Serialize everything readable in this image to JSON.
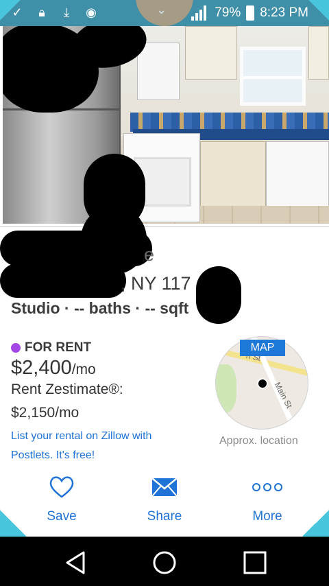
{
  "status_bar": {
    "battery": "79%",
    "time": "8:23 PM",
    "notification_icons": [
      "check-icon",
      "lock-icon",
      "download-icon",
      "messenger-icon"
    ]
  },
  "listing": {
    "address_prefix": "e",
    "address_partial": ", NY 117",
    "facts": "Studio · -- baths · -- sqft",
    "status": "FOR RENT",
    "status_color": "#a547e6",
    "price": "$2,400",
    "price_period": "/mo",
    "zestimate_label": "Rent Zestimate®:",
    "zestimate_value": "$2,150/mo",
    "promo": "List your rental on Zillow with Postlets. It's free!"
  },
  "map": {
    "badge": "MAP",
    "street_top": "n St",
    "street_main": "Main St",
    "caption": "Approx. location"
  },
  "actions": {
    "save": "Save",
    "share": "Share",
    "more": "More"
  },
  "colors": {
    "accent": "#1f73d6",
    "status_bar": "#3f8fa8"
  }
}
